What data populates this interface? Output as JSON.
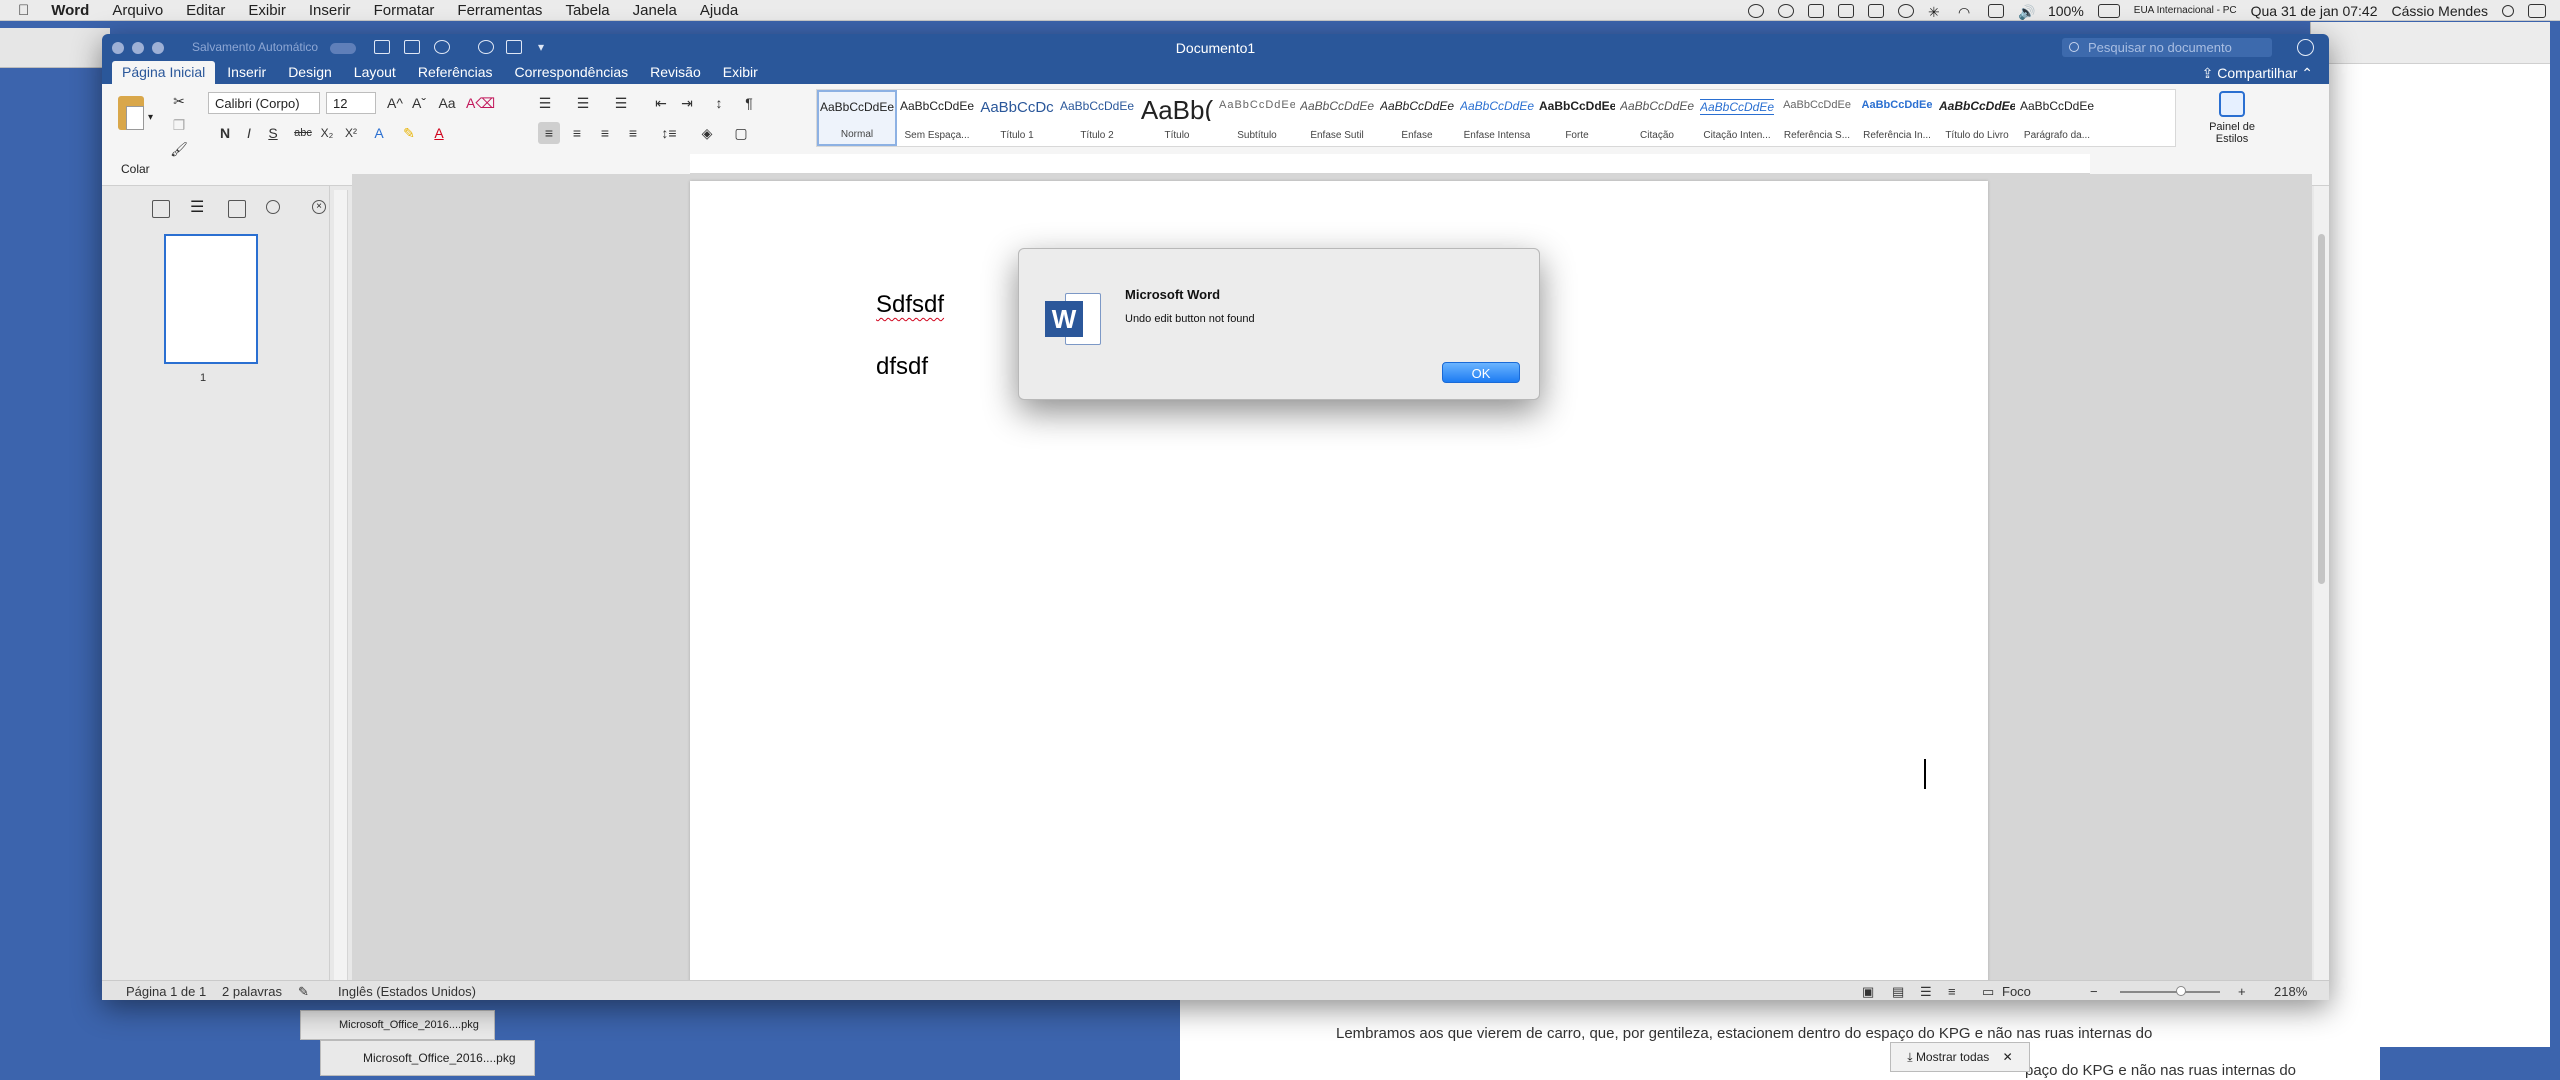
{
  "menubar": {
    "app": "Word",
    "items": [
      "Arquivo",
      "Editar",
      "Exibir",
      "Inserir",
      "Formatar",
      "Ferramentas",
      "Tabela",
      "Janela",
      "Ajuda"
    ],
    "battery": "100%",
    "input_source": "EUA Internacional - PC",
    "datetime": "Qua 31 de jan  07:42",
    "user": "Cássio Mendes"
  },
  "window": {
    "title": "Documento1",
    "autosave_label": "Salvamento Automático",
    "search_placeholder": "Pesquisar no documento",
    "share_label": "Compartilhar"
  },
  "tabs": [
    "Página Inicial",
    "Inserir",
    "Design",
    "Layout",
    "Referências",
    "Correspondências",
    "Revisão",
    "Exibir"
  ],
  "ribbon": {
    "paste_label": "Colar",
    "font_name": "Calibri (Corpo)",
    "font_size": "12",
    "styles": [
      {
        "preview": "AaBbCcDdEe",
        "name": "Normal"
      },
      {
        "preview": "AaBbCcDdEe",
        "name": "Sem Espaça..."
      },
      {
        "preview": "AaBbCcDc",
        "name": "Título 1"
      },
      {
        "preview": "AaBbCcDdEe",
        "name": "Título 2"
      },
      {
        "preview": "AaBb(",
        "name": "Título"
      },
      {
        "preview": "AaBbCcDdEe",
        "name": "Subtítulo"
      },
      {
        "preview": "AaBbCcDdEe",
        "name": "Ênfase Sutil"
      },
      {
        "preview": "AaBbCcDdEe",
        "name": "Ênfase"
      },
      {
        "preview": "AaBbCcDdEe",
        "name": "Ênfase Intensa"
      },
      {
        "preview": "AaBbCcDdEe",
        "name": "Forte"
      },
      {
        "preview": "AaBbCcDdEe",
        "name": "Citação"
      },
      {
        "preview": "AaBbCcDdEe",
        "name": "Citação Inten..."
      },
      {
        "preview": "AaBbCcDdEe",
        "name": "Referência S..."
      },
      {
        "preview": "AaBbCcDdEe",
        "name": "Referência In..."
      },
      {
        "preview": "AaBbCcDdEe",
        "name": "Título do Livro"
      },
      {
        "preview": "AaBbCcDdEe",
        "name": "Parágrafo da..."
      }
    ],
    "styles_pane_label_1": "Painel de",
    "styles_pane_label_2": "Estilos"
  },
  "navpane": {
    "thumb_page_number": "1"
  },
  "document": {
    "paragraphs": [
      "Sdfsdf",
      "dfsdf"
    ]
  },
  "statusbar": {
    "page": "Página 1 de 1",
    "words": "2 palavras",
    "language": "Inglês (Estados Unidos)",
    "focus": "Foco",
    "zoom": "218%"
  },
  "dialog": {
    "title": "Microsoft Word",
    "message": "Undo edit button not found",
    "ok": "OK"
  },
  "background": {
    "download_1": "Microsoft_Office_2016....pkg",
    "download_2": "Microsoft_Office_2016....pkg",
    "show_all": "Mostrar todas",
    "text_1": "Lembramos aos que vierem de carro, que, por gentileza, estacionem dentro do espaço do KPG  e não nas ruas internas do",
    "text_2": "paço do KPG  e não nas ruas internas do"
  }
}
